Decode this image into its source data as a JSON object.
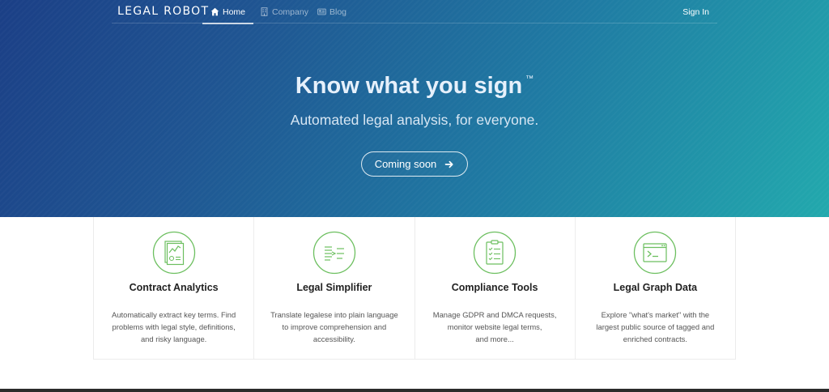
{
  "navbar": {
    "brand": "LEGAL ROBOT",
    "items": [
      {
        "label": "Home",
        "icon": "home-icon",
        "active": true
      },
      {
        "label": "Company",
        "icon": "building-icon",
        "active": false
      },
      {
        "label": "Blog",
        "icon": "newspaper-icon",
        "active": false
      }
    ],
    "sign_in": "Sign In"
  },
  "hero": {
    "title": "Know what you sign",
    "trademark": "™",
    "subtitle": "Automated legal analysis, for everyone.",
    "cta_label": "Coming soon",
    "cta_icon": "arrow-right-icon"
  },
  "features": [
    {
      "title": "Contract Analytics",
      "icon": "contract-chart-icon",
      "lines": [
        "Automatically extract key terms. Find",
        "problems with legal style, definitions,",
        "and risky language."
      ]
    },
    {
      "title": "Legal Simplifier",
      "icon": "document-text-icon",
      "lines": [
        "Translate legalese into plain language",
        "to improve comprehension and",
        "accessibility."
      ]
    },
    {
      "title": "Compliance Tools",
      "icon": "clipboard-checklist-icon",
      "lines": [
        "Manage GDPR and DMCA requests,",
        "monitor website legal terms,",
        "and more..."
      ]
    },
    {
      "title": "Legal Graph Data",
      "icon": "terminal-window-icon",
      "lines": [
        "Explore \"what's market\" with the",
        "largest public source of tagged and",
        "enriched contracts."
      ]
    }
  ],
  "colors": {
    "hero_start": "#1b3f86",
    "hero_end": "#22a9ad",
    "feature_icon": "#6cbf5f"
  }
}
